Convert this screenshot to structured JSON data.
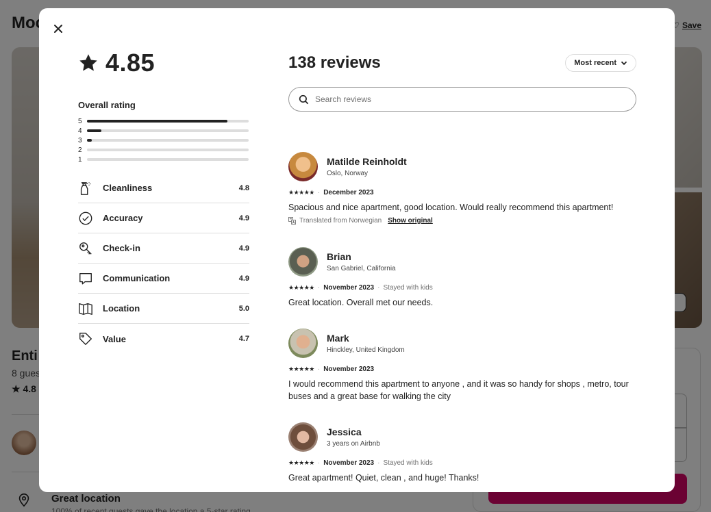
{
  "background": {
    "listing_title": "Moc",
    "save_label": "Save",
    "subtitle": "Enti",
    "guests": "8 gues",
    "rating": "4.8",
    "location_title": "Great location",
    "location_sub": "100% of recent guests gave the location a 5-star rating"
  },
  "summary": {
    "rating": "4.85",
    "overall_label": "Overall rating",
    "distribution": [
      {
        "stars": "5",
        "fraction": 0.87
      },
      {
        "stars": "4",
        "fraction": 0.09
      },
      {
        "stars": "3",
        "fraction": 0.03
      },
      {
        "stars": "2",
        "fraction": 0.0
      },
      {
        "stars": "1",
        "fraction": 0.0
      }
    ],
    "categories": [
      {
        "name": "Cleanliness",
        "value": "4.8",
        "icon": "spray-bottle-icon"
      },
      {
        "name": "Accuracy",
        "value": "4.9",
        "icon": "check-circle-icon"
      },
      {
        "name": "Check-in",
        "value": "4.9",
        "icon": "key-icon"
      },
      {
        "name": "Communication",
        "value": "4.9",
        "icon": "chat-bubble-icon"
      },
      {
        "name": "Location",
        "value": "5.0",
        "icon": "map-icon"
      },
      {
        "name": "Value",
        "value": "4.7",
        "icon": "tag-icon"
      }
    ]
  },
  "reviews_panel": {
    "count_label": "138 reviews",
    "sort_label": "Most recent",
    "search_placeholder": "Search reviews"
  },
  "reviews": [
    {
      "name": "Matilde Reinholdt",
      "location": "Oslo, Norway",
      "stars": "★★★★★",
      "date": "December 2023",
      "extra": "",
      "text": "Spacious and nice apartment, good location. Would really recommend this apartment!",
      "translated": "Translated from Norwegian",
      "show_original": "Show original"
    },
    {
      "name": "Brian",
      "location": "San Gabriel, California",
      "stars": "★★★★★",
      "date": "November 2023",
      "extra": "Stayed with kids",
      "text": "Great location. Overall met our needs."
    },
    {
      "name": "Mark",
      "location": "Hinckley, United Kingdom",
      "stars": "★★★★★",
      "date": "November 2023",
      "extra": "",
      "text": "I would recommend this apartment to anyone , and it was so handy for shops , metro, tour buses and a great base for walking the city"
    },
    {
      "name": "Jessica",
      "location": "3 years on Airbnb",
      "stars": "★★★★★",
      "date": "November 2023",
      "extra": "Stayed with kids",
      "text": "Great apartment! Quiet, clean , and huge! Thanks!"
    }
  ]
}
